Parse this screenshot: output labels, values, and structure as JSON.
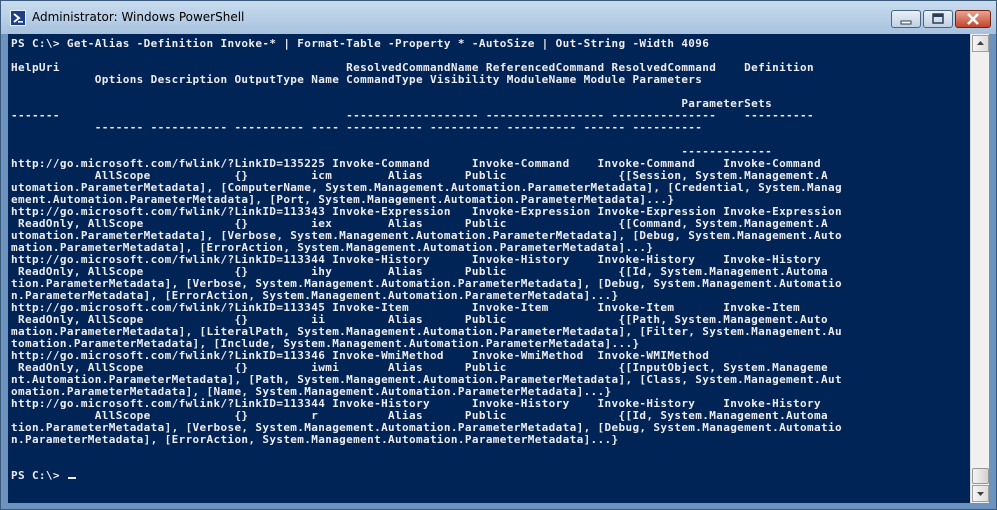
{
  "window": {
    "title": "Administrator: Windows PowerShell",
    "icon": "powershell-icon"
  },
  "caption_buttons": {
    "minimize": "minimize-icon",
    "maximize": "maximize-icon",
    "close": "close-icon"
  },
  "console": {
    "output": "PS C:\\> Get-Alias -Definition Invoke-* | Format-Table -Property * -AutoSize | Out-String -Width 4096\n\nHelpUri                                         ResolvedCommandName ReferencedCommand ResolvedCommand    Definition\n            Options Description OutputType Name CommandType Visibility ModuleName Module Parameters\n\n                                                                                                ParameterSets\n-------                                         ------------------- ----------------- ---------------    ----------\n            ------- ----------- ---------- ---- ----------- ---------- ---------- ------ ----------\n\n                                                                                                -------------\nhttp://go.microsoft.com/fwlink/?LinkID=135225 Invoke-Command      Invoke-Command    Invoke-Command    Invoke-Command\n            AllScope            {}         icm        Alias      Public                {[Session, System.Management.A\nutomation.ParameterMetadata], [ComputerName, System.Management.Automation.ParameterMetadata], [Credential, System.Manag\nement.Automation.ParameterMetadata], [Port, System.Management.Automation.ParameterMetadata]...}\nhttp://go.microsoft.com/fwlink/?LinkID=113343 Invoke-Expression   Invoke-Expression Invoke-Expression Invoke-Expression\n ReadOnly, AllScope             {}         iex        Alias      Public                {[Command, System.Management.A\nutomation.ParameterMetadata], [Verbose, System.Management.Automation.ParameterMetadata], [Debug, System.Management.Auto\nmation.ParameterMetadata], [ErrorAction, System.Management.Automation.ParameterMetadata]...}\nhttp://go.microsoft.com/fwlink/?LinkID=113344 Invoke-History      Invoke-History    Invoke-History    Invoke-History\n ReadOnly, AllScope             {}         ihy        Alias      Public                {[Id, System.Management.Automa\ntion.ParameterMetadata], [Verbose, System.Management.Automation.ParameterMetadata], [Debug, System.Management.Automatio\nn.ParameterMetadata], [ErrorAction, System.Management.Automation.ParameterMetadata]...}\nhttp://go.microsoft.com/fwlink/?LinkID=113345 Invoke-Item         Invoke-Item       Invoke-Item       Invoke-Item\n ReadOnly, AllScope             {}         ii         Alias      Public                {[Path, System.Management.Auto\nmation.ParameterMetadata], [LiteralPath, System.Management.Automation.ParameterMetadata], [Filter, System.Management.Au\ntomation.ParameterMetadata], [Include, System.Management.Automation.ParameterMetadata]...}\nhttp://go.microsoft.com/fwlink/?LinkID=113346 Invoke-WmiMethod    Invoke-WmiMethod  Invoke-WMIMethod\n ReadOnly, AllScope             {}         iwmi       Alias      Public                {[InputObject, System.Manageme\nnt.Automation.ParameterMetadata], [Path, System.Management.Automation.ParameterMetadata], [Class, System.Management.Aut\nomation.ParameterMetadata], [Name, System.Management.Automation.ParameterMetadata]...}\nhttp://go.microsoft.com/fwlink/?LinkID=113344 Invoke-History      Invoke-History    Invoke-History    Invoke-History\n            AllScope            {}         r          Alias      Public                {[Id, System.Management.Automa\ntion.ParameterMetadata], [Verbose, System.Management.Automation.ParameterMetadata], [Debug, System.Management.Automatio\nn.ParameterMetadata], [ErrorAction, System.Management.Automation.ParameterMetadata]...}\n\n\n",
    "prompt": "PS C:\\> "
  },
  "colors": {
    "console_background": "#012456",
    "console_text": "#eeedf0",
    "title_bar": "#a7c2de",
    "close_button": "#c4442a"
  }
}
